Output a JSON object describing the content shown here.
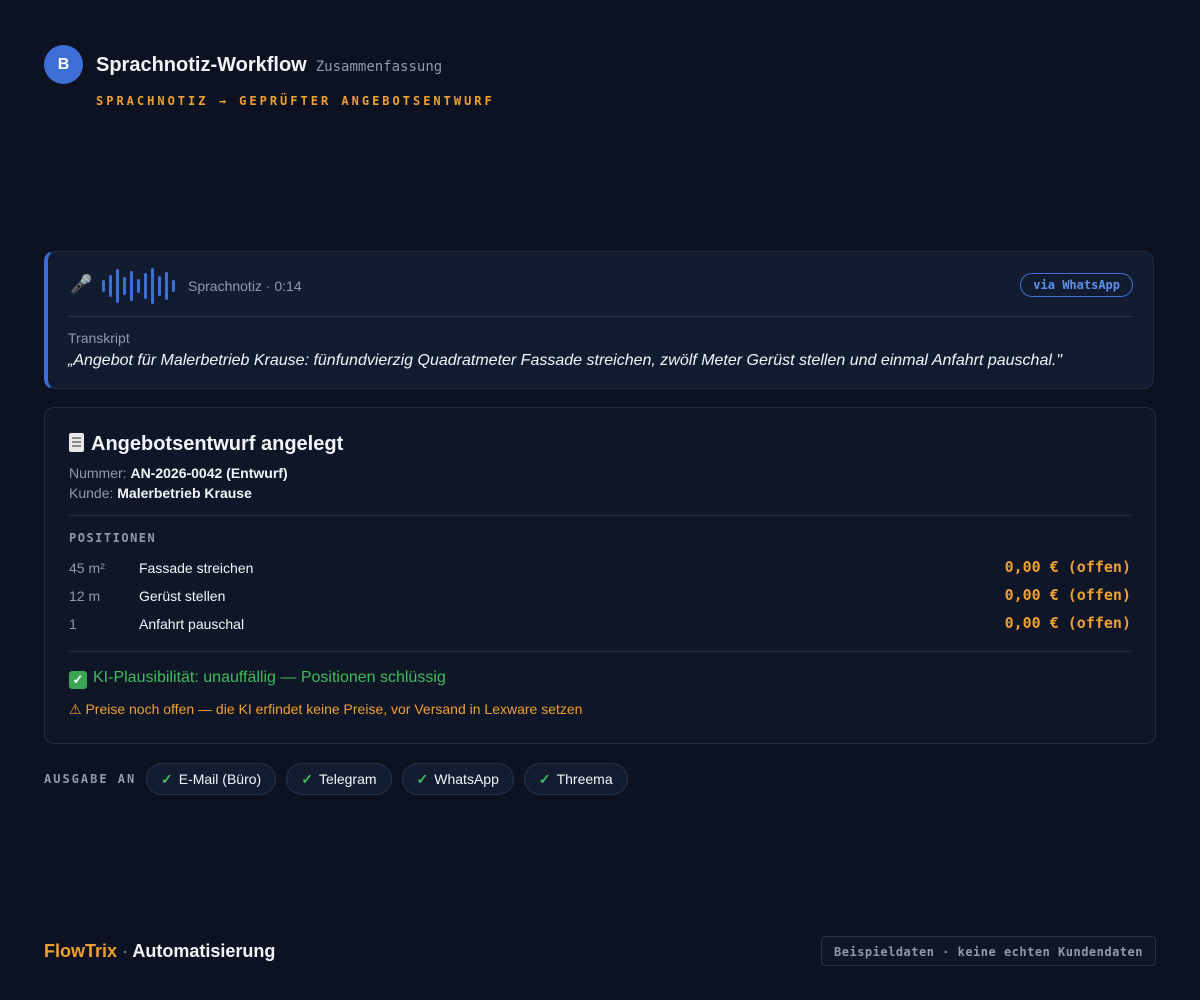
{
  "header": {
    "avatar_letter": "B",
    "title": "Sprachnotiz-Workflow",
    "subtitle": "Zusammenfassung",
    "tagline": "SPRACHNOTIZ → GEPRÜFTER ANGEBOTSENTWURF"
  },
  "voice_note": {
    "icon": "microphone-icon",
    "label": "Sprachnotiz · 0:14",
    "channel_badge": "via WhatsApp",
    "transcript_label": "Transkript",
    "transcript": "„Angebot für Malerbetrieb Krause: fünfundvierzig Quadratmeter Fassade streichen, zwölf Meter Gerüst stellen und einmal Anfahrt pauschal.\""
  },
  "offer": {
    "icon": "document-icon",
    "title": "Angebotsentwurf angelegt",
    "number_label": "Nummer:",
    "number_value": "AN-2026-0042 (Entwurf)",
    "customer_label": "Kunde:",
    "customer_value": "Malerbetrieb Krause",
    "positions_heading": "POSITIONEN",
    "positions": [
      {
        "qty": "45 m²",
        "description": "Fassade streichen",
        "price": "0,00 € (offen)"
      },
      {
        "qty": "12 m",
        "description": "Gerüst stellen",
        "price": "0,00 € (offen)"
      },
      {
        "qty": "1",
        "description": "Anfahrt pauschal",
        "price": "0,00 € (offen)"
      }
    ],
    "plausibility": "KI-Plausibilität: unauffällig — Positionen schlüssig",
    "warning": "⚠ Preise noch offen — die KI erfindet keine Preise, vor Versand in Lexware setzen"
  },
  "output": {
    "label": "AUSGABE AN",
    "check_mark": "✓",
    "channels": [
      "E-Mail (Büro)",
      "Telegram",
      "WhatsApp",
      "Threema"
    ]
  },
  "footer": {
    "brand_name": "FlowTrix",
    "brand_separator": "·",
    "brand_suffix": "Automatisierung",
    "disclaimer": "Beispieldaten · keine echten Kundendaten"
  },
  "colors": {
    "background": "#0c1221",
    "accent_blue": "#3d6fd6",
    "accent_orange": "#f0a030",
    "success_green": "#3dbd5a"
  }
}
